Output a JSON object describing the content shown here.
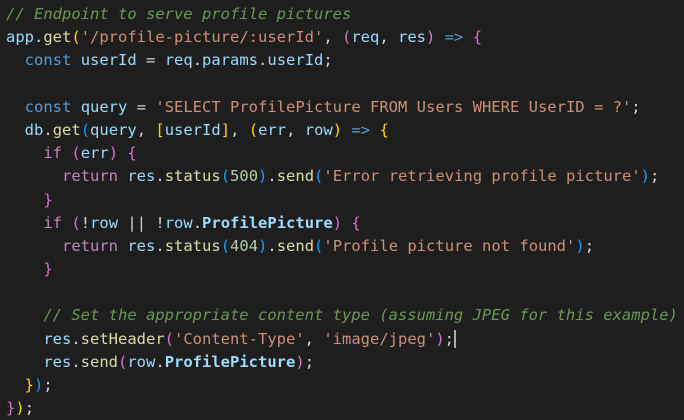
{
  "code_lines": [
    [
      {
        "t": "// Endpoint to serve profile pictures",
        "c": "comment"
      }
    ],
    [
      {
        "t": "app",
        "c": "ident"
      },
      {
        "t": ".",
        "c": "punc"
      },
      {
        "t": "get",
        "c": "method"
      },
      {
        "t": "(",
        "c": "b1"
      },
      {
        "t": "'/profile-picture/:userId'",
        "c": "str"
      },
      {
        "t": ", ",
        "c": "punc"
      },
      {
        "t": "(",
        "c": "b2"
      },
      {
        "t": "req",
        "c": "ident"
      },
      {
        "t": ", ",
        "c": "punc"
      },
      {
        "t": "res",
        "c": "ident"
      },
      {
        "t": ")",
        "c": "b2"
      },
      {
        "t": " ",
        "c": "punc"
      },
      {
        "t": "=>",
        "c": "storage"
      },
      {
        "t": " ",
        "c": "punc"
      },
      {
        "t": "{",
        "c": "b2"
      }
    ],
    [
      {
        "t": "  ",
        "c": "punc"
      },
      {
        "t": "const",
        "c": "storage"
      },
      {
        "t": " ",
        "c": "punc"
      },
      {
        "t": "userId",
        "c": "ident"
      },
      {
        "t": " = ",
        "c": "punc"
      },
      {
        "t": "req",
        "c": "ident"
      },
      {
        "t": ".",
        "c": "punc"
      },
      {
        "t": "params",
        "c": "ident"
      },
      {
        "t": ".",
        "c": "punc"
      },
      {
        "t": "userId",
        "c": "ident"
      },
      {
        "t": ";",
        "c": "punc"
      }
    ],
    [
      {
        "t": "",
        "c": "punc"
      }
    ],
    [
      {
        "t": "  ",
        "c": "punc"
      },
      {
        "t": "const",
        "c": "storage"
      },
      {
        "t": " ",
        "c": "punc"
      },
      {
        "t": "query",
        "c": "ident"
      },
      {
        "t": " = ",
        "c": "punc"
      },
      {
        "t": "'SELECT ProfilePicture FROM Users WHERE UserID = ?'",
        "c": "str"
      },
      {
        "t": ";",
        "c": "punc"
      }
    ],
    [
      {
        "t": "  ",
        "c": "punc"
      },
      {
        "t": "db",
        "c": "ident"
      },
      {
        "t": ".",
        "c": "punc"
      },
      {
        "t": "get",
        "c": "method"
      },
      {
        "t": "(",
        "c": "b3"
      },
      {
        "t": "query",
        "c": "ident"
      },
      {
        "t": ", ",
        "c": "punc"
      },
      {
        "t": "[",
        "c": "b1"
      },
      {
        "t": "userId",
        "c": "ident"
      },
      {
        "t": "]",
        "c": "b1"
      },
      {
        "t": ", ",
        "c": "punc"
      },
      {
        "t": "(",
        "c": "b1"
      },
      {
        "t": "err",
        "c": "ident"
      },
      {
        "t": ", ",
        "c": "punc"
      },
      {
        "t": "row",
        "c": "ident"
      },
      {
        "t": ")",
        "c": "b1"
      },
      {
        "t": " ",
        "c": "punc"
      },
      {
        "t": "=>",
        "c": "storage"
      },
      {
        "t": " ",
        "c": "punc"
      },
      {
        "t": "{",
        "c": "b1"
      }
    ],
    [
      {
        "t": "    ",
        "c": "punc"
      },
      {
        "t": "if",
        "c": "control"
      },
      {
        "t": " ",
        "c": "punc"
      },
      {
        "t": "(",
        "c": "b2"
      },
      {
        "t": "err",
        "c": "ident"
      },
      {
        "t": ")",
        "c": "b2"
      },
      {
        "t": " ",
        "c": "punc"
      },
      {
        "t": "{",
        "c": "b2"
      }
    ],
    [
      {
        "t": "      ",
        "c": "punc"
      },
      {
        "t": "return",
        "c": "control"
      },
      {
        "t": " ",
        "c": "punc"
      },
      {
        "t": "res",
        "c": "ident"
      },
      {
        "t": ".",
        "c": "punc"
      },
      {
        "t": "status",
        "c": "method"
      },
      {
        "t": "(",
        "c": "b3"
      },
      {
        "t": "500",
        "c": "num"
      },
      {
        "t": ")",
        "c": "b3"
      },
      {
        "t": ".",
        "c": "punc"
      },
      {
        "t": "send",
        "c": "method"
      },
      {
        "t": "(",
        "c": "b3"
      },
      {
        "t": "'Error retrieving profile picture'",
        "c": "str"
      },
      {
        "t": ")",
        "c": "b3"
      },
      {
        "t": ";",
        "c": "punc"
      }
    ],
    [
      {
        "t": "    ",
        "c": "punc"
      },
      {
        "t": "}",
        "c": "b2"
      }
    ],
    [
      {
        "t": "    ",
        "c": "punc"
      },
      {
        "t": "if",
        "c": "control"
      },
      {
        "t": " ",
        "c": "punc"
      },
      {
        "t": "(",
        "c": "b2"
      },
      {
        "t": "!",
        "c": "op"
      },
      {
        "t": "row",
        "c": "ident"
      },
      {
        "t": " || ",
        "c": "op"
      },
      {
        "t": "!",
        "c": "op"
      },
      {
        "t": "row",
        "c": "ident"
      },
      {
        "t": ".",
        "c": "punc"
      },
      {
        "t": "ProfilePicture",
        "c": "ident bold"
      },
      {
        "t": ")",
        "c": "b2"
      },
      {
        "t": " ",
        "c": "punc"
      },
      {
        "t": "{",
        "c": "b2"
      }
    ],
    [
      {
        "t": "      ",
        "c": "punc"
      },
      {
        "t": "return",
        "c": "control"
      },
      {
        "t": " ",
        "c": "punc"
      },
      {
        "t": "res",
        "c": "ident"
      },
      {
        "t": ".",
        "c": "punc"
      },
      {
        "t": "status",
        "c": "method"
      },
      {
        "t": "(",
        "c": "b3"
      },
      {
        "t": "404",
        "c": "num"
      },
      {
        "t": ")",
        "c": "b3"
      },
      {
        "t": ".",
        "c": "punc"
      },
      {
        "t": "send",
        "c": "method"
      },
      {
        "t": "(",
        "c": "b3"
      },
      {
        "t": "'Profile picture not found'",
        "c": "str"
      },
      {
        "t": ")",
        "c": "b3"
      },
      {
        "t": ";",
        "c": "punc"
      }
    ],
    [
      {
        "t": "    ",
        "c": "punc"
      },
      {
        "t": "}",
        "c": "b2"
      }
    ],
    [
      {
        "t": "",
        "c": "punc"
      }
    ],
    [
      {
        "t": "    ",
        "c": "punc"
      },
      {
        "t": "// Set the appropriate content type (assuming JPEG for this example)",
        "c": "comment"
      }
    ],
    [
      {
        "t": "    ",
        "c": "punc"
      },
      {
        "t": "res",
        "c": "ident"
      },
      {
        "t": ".",
        "c": "punc"
      },
      {
        "t": "setHeader",
        "c": "method"
      },
      {
        "t": "(",
        "c": "b2"
      },
      {
        "t": "'Content-Type'",
        "c": "str"
      },
      {
        "t": ", ",
        "c": "punc"
      },
      {
        "t": "'image/jpeg'",
        "c": "str"
      },
      {
        "t": ")",
        "c": "b2"
      },
      {
        "t": ";",
        "c": "punc"
      }
    ],
    [
      {
        "t": "    ",
        "c": "punc"
      },
      {
        "t": "res",
        "c": "ident"
      },
      {
        "t": ".",
        "c": "punc"
      },
      {
        "t": "send",
        "c": "method"
      },
      {
        "t": "(",
        "c": "b2"
      },
      {
        "t": "row",
        "c": "ident"
      },
      {
        "t": ".",
        "c": "punc"
      },
      {
        "t": "ProfilePicture",
        "c": "ident bold"
      },
      {
        "t": ")",
        "c": "b2"
      },
      {
        "t": ";",
        "c": "punc"
      }
    ],
    [
      {
        "t": "  ",
        "c": "punc"
      },
      {
        "t": "}",
        "c": "b1"
      },
      {
        "t": ")",
        "c": "b3"
      },
      {
        "t": ";",
        "c": "punc"
      }
    ],
    [
      {
        "t": "}",
        "c": "b2"
      },
      {
        "t": ")",
        "c": "b1"
      },
      {
        "t": ";",
        "c": "punc"
      }
    ]
  ],
  "cursor_line": 14,
  "theme": {
    "background": "#1e1e1e",
    "comment": "#6a9955",
    "string": "#ce9178",
    "keyword": "#569cd6",
    "control": "#c586c0",
    "function": "#dcdcaa",
    "variable": "#9cdcfe",
    "number": "#b5cea8"
  }
}
